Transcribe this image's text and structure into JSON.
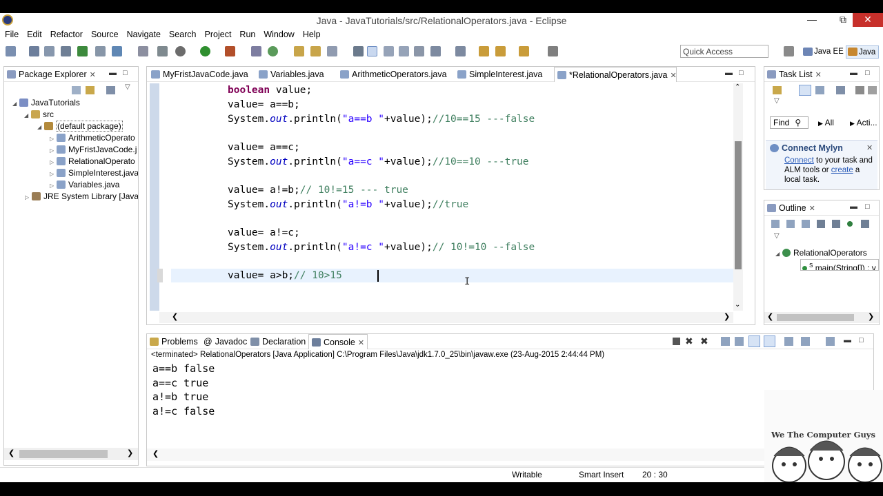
{
  "window": {
    "title": "Java - JavaTutorials/src/RelationalOperators.java - Eclipse"
  },
  "menu": [
    "File",
    "Edit",
    "Refactor",
    "Source",
    "Navigate",
    "Search",
    "Project",
    "Run",
    "Window",
    "Help"
  ],
  "toolbar": {
    "quick_access_placeholder": "Quick Access",
    "perspectives": [
      "Java EE",
      "Java"
    ]
  },
  "package_explorer": {
    "title": "Package Explorer",
    "items": [
      {
        "label": "JavaTutorials"
      },
      {
        "label": "src"
      },
      {
        "label": "(default package)"
      },
      {
        "label": "ArithmeticOperato"
      },
      {
        "label": "MyFristJavaCode.j"
      },
      {
        "label": "RelationalOperato"
      },
      {
        "label": "SimpleInterest.java"
      },
      {
        "label": "Variables.java"
      },
      {
        "label": "JRE System Library [JavaSE"
      }
    ]
  },
  "editor": {
    "tabs": [
      "MyFristJavaCode.java",
      "Variables.java",
      "ArithmeticOperators.java",
      "SimpleInterest.java",
      "*RelationalOperators.java"
    ],
    "active_tab": 4,
    "code": {
      "l1_kw": "boolean",
      "l1_rest": " value;",
      "l2": "value= a==b;",
      "l3_a": "System.",
      "l3_fld": "out",
      "l3_b": ".println(",
      "l3_str": "\"a==b \"",
      "l3_c": "+value);",
      "l3_com": "//10==15 ---false",
      "l4": "value= a==c;",
      "l5_a": "System.",
      "l5_fld": "out",
      "l5_b": ".println(",
      "l5_str": "\"a==c \"",
      "l5_c": "+value);",
      "l5_com": "//10==10 ---true",
      "l6_a": "value= a!=b;",
      "l6_com": "// 10!=15 --- true",
      "l7_a": "System.",
      "l7_fld": "out",
      "l7_b": ".println(",
      "l7_str": "\"a!=b \"",
      "l7_c": "+value);",
      "l7_com": "//true",
      "l8": "value= a!=c;",
      "l9_a": "System.",
      "l9_fld": "out",
      "l9_b": ".println(",
      "l9_str": "\"a!=c \"",
      "l9_c": "+value);",
      "l9_com": "// 10!=10 --false",
      "l10_a": "value= a>b;",
      "l10_com": "// 10>15"
    }
  },
  "task_list": {
    "title": "Task List",
    "find": "Find",
    "all": "All",
    "acti": "Acti..."
  },
  "mylyn": {
    "title": "Connect Mylyn",
    "connect": "Connect",
    "text1": " to your task and ALM tools or ",
    "create": "create",
    "text2": " a local task."
  },
  "outline": {
    "title": "Outline",
    "class": "RelationalOperators",
    "method_sup": "S",
    "method": "main(String[]) : v"
  },
  "console": {
    "tabs": [
      "Problems",
      "Javadoc",
      "Declaration",
      "Console"
    ],
    "active_tab": 3,
    "header": "<terminated> RelationalOperators [Java Application] C:\\Program Files\\Java\\jdk1.7.0_25\\bin\\javaw.exe (23-Aug-2015 2:44:44 PM)",
    "lines": [
      "a==b false",
      "a==c true",
      "a!=b true",
      "a!=c false"
    ]
  },
  "status": {
    "mode": "Writable",
    "insert": "Smart Insert",
    "position": "20 : 30"
  },
  "watermark": {
    "text": "We The Computer Guys"
  }
}
